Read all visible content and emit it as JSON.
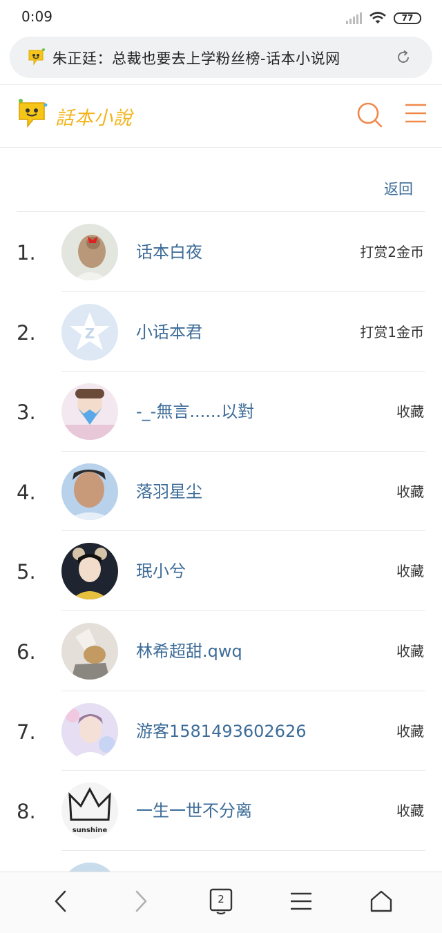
{
  "status_bar": {
    "time": "0:09",
    "battery": "77"
  },
  "address_bar": {
    "title": "朱正廷：总裁也要去上学粉丝榜-话本小说网"
  },
  "site_header": {
    "logo_text": "話本小說",
    "brand_color": "#f3b31a",
    "accent_color": "#f0884a"
  },
  "back_label": "返回",
  "fans": [
    {
      "rank": "1.",
      "name": "话本白夜",
      "action": "打赏2金币",
      "avatar": "avatar-1"
    },
    {
      "rank": "2.",
      "name": "小话本君",
      "action": "打赏1金币",
      "avatar": "avatar-2"
    },
    {
      "rank": "3.",
      "name": "-_-無言......以對",
      "action": "收藏",
      "avatar": "avatar-3"
    },
    {
      "rank": "4.",
      "name": "落羽星尘",
      "action": "收藏",
      "avatar": "avatar-4"
    },
    {
      "rank": "5.",
      "name": "珉小兮",
      "action": "收藏",
      "avatar": "avatar-5"
    },
    {
      "rank": "6.",
      "name": "林希超甜.qwq",
      "action": "收藏",
      "avatar": "avatar-6"
    },
    {
      "rank": "7.",
      "name": "游客1581493602626",
      "action": "收藏",
      "avatar": "avatar-7"
    },
    {
      "rank": "8.",
      "name": "一生一世不分离",
      "action": "收藏",
      "avatar": "avatar-8",
      "avatar_text": "sunshine"
    }
  ],
  "bottom_nav": {
    "tab_count": "2"
  }
}
